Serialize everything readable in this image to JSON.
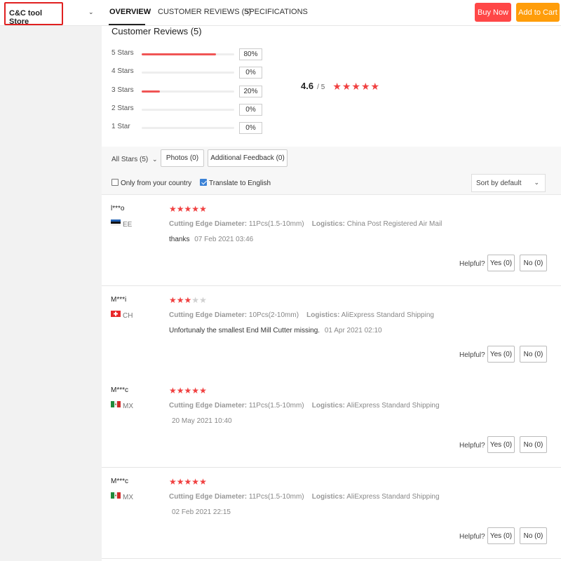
{
  "header": {
    "store_name": "C&C tool Store",
    "tabs": [
      {
        "label": "OVERVIEW",
        "active": true
      },
      {
        "label": "CUSTOMER REVIEWS (5)",
        "active": false
      },
      {
        "label": "SPECIFICATIONS",
        "active": false
      }
    ],
    "buy_now": "Buy Now",
    "add_to_cart": "Add to Cart"
  },
  "colors": {
    "accent_red": "#ff4747",
    "accent_orange": "#ff9d0a",
    "star": "#f04040"
  },
  "summary": {
    "title": "Customer Reviews (5)",
    "distribution": [
      {
        "label": "5 Stars",
        "percent": 80,
        "percent_text": "80%"
      },
      {
        "label": "4 Stars",
        "percent": 0,
        "percent_text": "0%"
      },
      {
        "label": "3 Stars",
        "percent": 20,
        "percent_text": "20%"
      },
      {
        "label": "2 Stars",
        "percent": 0,
        "percent_text": "0%"
      },
      {
        "label": "1 Star",
        "percent": 0,
        "percent_text": "0%"
      }
    ],
    "average": "4.6",
    "out_of": "/ 5",
    "average_stars": 4.6
  },
  "filters": {
    "all_stars": "All Stars (5)",
    "photos": "Photos (0)",
    "additional_feedback": "Additional Feedback (0)",
    "only_country": "Only from your country",
    "only_country_checked": false,
    "translate": "Translate to English",
    "translate_checked": true,
    "sort": "Sort by default"
  },
  "reviews": [
    {
      "user": "l***o",
      "country": "EE",
      "flag": "flag-estonia-icon",
      "stars": 5,
      "diameter_label": "Cutting Edge Diameter:",
      "diameter": "11Pcs(1.5-10mm)",
      "logistics_label": "Logistics:",
      "logistics": "China Post Registered Air Mail",
      "text": "thanks",
      "date": "07 Feb 2021 03:46",
      "helpful": "Helpful?",
      "yes": "Yes (0)",
      "no": "No (0)"
    },
    {
      "user": "M***i",
      "country": "CH",
      "flag": "flag-switzerland-icon",
      "stars": 3,
      "diameter_label": "Cutting Edge Diameter:",
      "diameter": "10Pcs(2-10mm)",
      "logistics_label": "Logistics:",
      "logistics": "AliExpress Standard Shipping",
      "text": "Unfortunaly the smallest End Mill Cutter missing.",
      "date": "01 Apr 2021 02:10",
      "helpful": "Helpful?",
      "yes": "Yes (0)",
      "no": "No (0)"
    },
    {
      "user": "M***c",
      "country": "MX",
      "flag": "flag-mexico-icon",
      "stars": 5,
      "diameter_label": "Cutting Edge Diameter:",
      "diameter": "11Pcs(1.5-10mm)",
      "logistics_label": "Logistics:",
      "logistics": "AliExpress Standard Shipping",
      "text": "",
      "date": "20 May 2021 10:40",
      "helpful": "Helpful?",
      "yes": "Yes (0)",
      "no": "No (0)"
    },
    {
      "user": "M***c",
      "country": "MX",
      "flag": "flag-mexico-icon",
      "stars": 5,
      "diameter_label": "Cutting Edge Diameter:",
      "diameter": "11Pcs(1.5-10mm)",
      "logistics_label": "Logistics:",
      "logistics": "AliExpress Standard Shipping",
      "text": "",
      "date": "02 Feb 2021 22:15",
      "helpful": "Helpful?",
      "yes": "Yes (0)",
      "no": "No (0)"
    }
  ]
}
